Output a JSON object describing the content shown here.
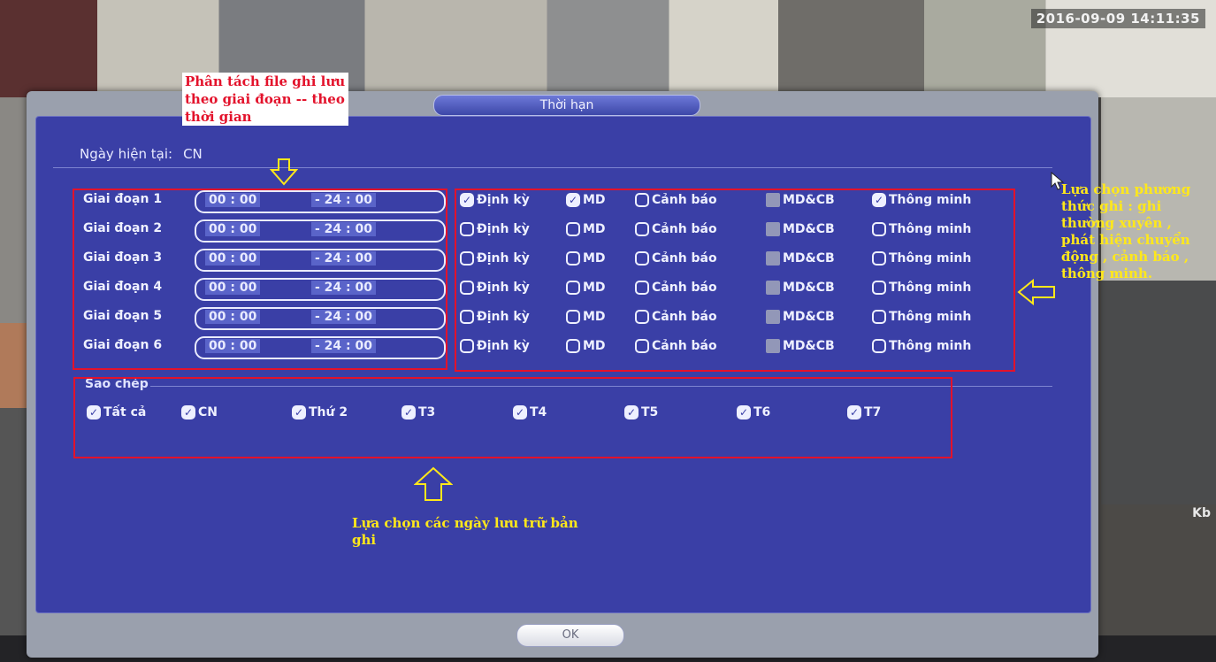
{
  "timestamp": "2016-09-09 14:11:35",
  "side_label": "Kb",
  "dialog": {
    "title": "Thời hạn",
    "current_day_label": "Ngày hiện tại:",
    "current_day_value": "CN",
    "ok_label": "OK"
  },
  "periods": [
    {
      "label": "Giai đoạn 1",
      "start": "00 : 00",
      "end": "- 24 : 00"
    },
    {
      "label": "Giai đoạn 2",
      "start": "00 : 00",
      "end": "- 24 : 00"
    },
    {
      "label": "Giai đoạn 3",
      "start": "00 : 00",
      "end": "- 24 : 00"
    },
    {
      "label": "Giai đoạn 4",
      "start": "00 : 00",
      "end": "- 24 : 00"
    },
    {
      "label": "Giai đoạn 5",
      "start": "00 : 00",
      "end": "- 24 : 00"
    },
    {
      "label": "Giai đoạn 6",
      "start": "00 : 00",
      "end": "- 24 : 00"
    }
  ],
  "mode_labels": [
    "Định kỳ",
    "MD",
    "Cảnh báo",
    "MD&CB",
    "Thông minh"
  ],
  "mode_states": [
    [
      true,
      true,
      false,
      false,
      true
    ],
    [
      false,
      false,
      false,
      false,
      false
    ],
    [
      false,
      false,
      false,
      false,
      false
    ],
    [
      false,
      false,
      false,
      false,
      false
    ],
    [
      false,
      false,
      false,
      false,
      false
    ],
    [
      false,
      false,
      false,
      false,
      false
    ]
  ],
  "copy": {
    "title": "Sao chép",
    "days": [
      {
        "label": "Tất cả",
        "checked": true
      },
      {
        "label": "CN",
        "checked": true
      },
      {
        "label": "Thứ 2",
        "checked": true
      },
      {
        "label": "T3",
        "checked": true
      },
      {
        "label": "T4",
        "checked": true
      },
      {
        "label": "T5",
        "checked": true
      },
      {
        "label": "T6",
        "checked": true
      },
      {
        "label": "T7",
        "checked": true
      }
    ]
  },
  "annotations": {
    "periods_note": "Phân tách file ghi lưu theo giai đoạn -- theo thời gian",
    "modes_note": "Lựa chọn phương thức ghi : ghi thường xuyên , phát hiện chuyển động , cảnh báo , thông minh.",
    "days_note": "Lựa chọn các ngày lưu trữ bản ghi"
  },
  "colors": {
    "panel": "#3a3fa6",
    "annotation_box": "#e3122b",
    "annotation_text_yellow": "#ffe81a"
  }
}
